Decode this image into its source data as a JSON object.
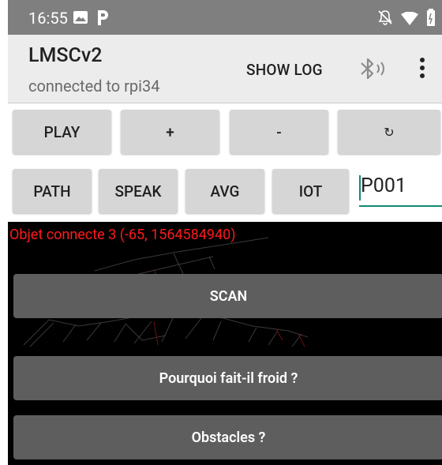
{
  "status_bar": {
    "time": "16:55"
  },
  "app_bar": {
    "title": "LMSCv2",
    "subtitle": "connected to rpi34",
    "show_log": "SHOW LOG"
  },
  "controls": {
    "row1": [
      "PLAY",
      "+",
      "-",
      "↻"
    ],
    "row2": [
      "PATH",
      "SPEAK",
      "AVG",
      "IOT"
    ],
    "id_field_value": "P001"
  },
  "map": {
    "status_text": "Objet connecte 3 (-65, 1564584940)",
    "buttons": [
      "SCAN",
      "Pourquoi fait-il froid ?",
      "Obstacles ?"
    ]
  },
  "colors": {
    "status_bar": "#7f7f7f",
    "app_bar": "#ececec",
    "accent": "#138a72",
    "alert_text": "#ff1a1a",
    "map_background": "#000000",
    "action_button": "#5e5e5e"
  }
}
